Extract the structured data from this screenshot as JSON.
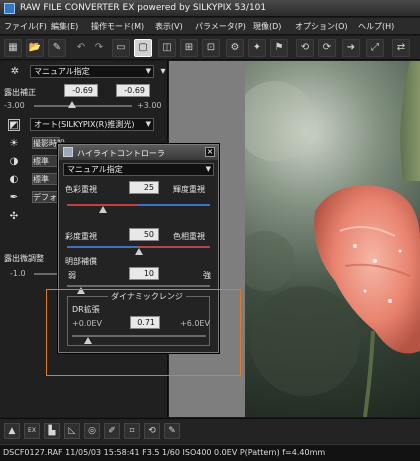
{
  "window": {
    "title": "RAW FILE CONVERTER EX powered by SILKYPIX  53/101"
  },
  "menu": {
    "items": [
      "ファイル(F)",
      "編集(E)",
      "操作モード(M)",
      "表示(V)",
      "パラメータ(P)",
      "現像(D)",
      "オプション(O)",
      "ヘルプ(H)"
    ]
  },
  "toolbar": {
    "icons": [
      "grid-view-icon",
      "folder-open-icon",
      "develop-icon",
      "undo-icon",
      "redo-icon",
      "single-view-icon",
      "preview-icon",
      "sharpen-icon",
      "crop-icon",
      "aspect-icon",
      "gear-icon",
      "magic-wand-icon",
      "run-icon",
      "rotate-left-icon",
      "rotate-right-icon",
      "forward-icon"
    ]
  },
  "left_panel": {
    "preset_combo": "マニュアル指定",
    "exposure": {
      "label": "露出補正",
      "value_left": "-0.69",
      "value_right": "-0.69",
      "range_min": "-3.00",
      "range_max": "+3.00",
      "level": 0.39
    },
    "wb_combo": "オート(SILKYPIX(R)推測光)",
    "rows": [
      "撮影時設",
      "標準",
      "標準",
      "デフォ"
    ],
    "fine_label": "露出微調整",
    "fine_min": "-1.0"
  },
  "dialog": {
    "title": "ハイライトコントローラ",
    "combo": "マニュアル指定",
    "color_left": "色彩重視",
    "color_right": "輝度重視",
    "color_value": "25",
    "color_level": 0.25,
    "sat_left": "彩度重視",
    "sat_right": "色相重視",
    "sat_value": "50",
    "sat_level": 0.5,
    "bright_label": "明部補償",
    "bright_weak": "弱",
    "bright_strong": "強",
    "bright_value": "10",
    "bright_level": 0.1,
    "dr_group": "ダイナミックレンジ",
    "dr_label": "DR拡張",
    "dr_min": "+0.0EV",
    "dr_max": "+6.0EV",
    "dr_value": "0.71",
    "dr_level": 0.12,
    "close": "×"
  },
  "bottom_tools": {
    "icons": [
      "pointer-icon",
      "exif-icon",
      "levels-icon",
      "curve-icon",
      "circle-icon",
      "paint-icon",
      "crop-frame-icon",
      "rotate-icon",
      "eyedropper-icon"
    ]
  },
  "status": {
    "text": "DSCF0127.RAF 11/05/03 15:58:41  F3.5 1/60 ISO400  0.0EV P(Pattern) f=4.40mm"
  },
  "colors": {
    "accent_orange": "#e07a2a",
    "slider_red": "#c04040",
    "slider_blue": "#3a72c8",
    "petal": "#e8836f"
  }
}
